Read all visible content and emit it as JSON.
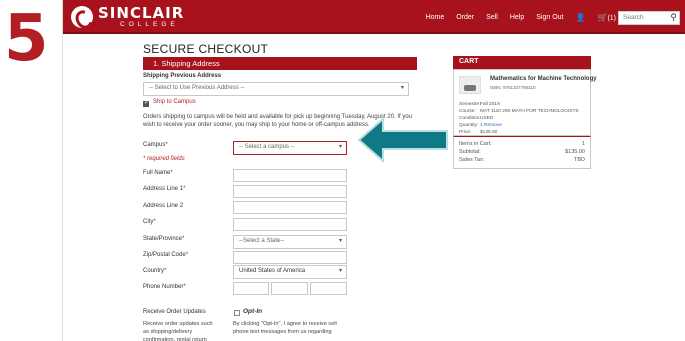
{
  "step": "5",
  "brand": {
    "name": "SINCLAIR",
    "sub": "COLLEGE"
  },
  "nav": [
    "Home",
    "Order",
    "Sell",
    "Help",
    "Sign Out"
  ],
  "cart_count": "(1)",
  "search_placeholder": "Search",
  "title": "SECURE CHECKOUT",
  "section": "1. Shipping Address",
  "shipping_prev_label": "Shipping Previous Address",
  "shipping_prev_select": "-- Select to Use Previous Address --",
  "ship_campus": "Ship to Campus",
  "ship_text": "Orders shipping to campus will be held and available for pick up beginning Tuesday, August 20. If you wish to receive your order sooner, you may ship to your home or off-campus address.",
  "campus_label": "Campus",
  "campus_select": "-- Select a campus --",
  "required_note": "* required fields",
  "fields": [
    {
      "label": "Full Name",
      "star": "*"
    },
    {
      "label": "Address Line 1",
      "star": "*"
    },
    {
      "label": "Address Line 2",
      "star": ""
    },
    {
      "label": "City",
      "star": "*"
    },
    {
      "label": "State/Province",
      "star": "*"
    },
    {
      "label": "Zip/Postal Code",
      "star": "*"
    },
    {
      "label": "Country",
      "star": "*"
    },
    {
      "label": "Phone Number",
      "star": "*"
    }
  ],
  "state_select": "--Select a State--",
  "country_select": "United States of America",
  "updates_label": "Receive Order Updates",
  "updates_text": "Receive order updates such as shipping/delivery confirmation, rental return",
  "optin_label": "Opt-In",
  "optin_text": "By clicking \"Opt-In\", I agree to receive cell phone text messages from us regarding",
  "cart": {
    "header": "CART",
    "book_title": "Mathematics for Machine Technology",
    "isbn": "ISBN: 9781337798310",
    "details": [
      {
        "k": "Semester:",
        "v": "Fall 2019"
      },
      {
        "k": "Course:",
        "v": "MAT 1110 290 MATH FOR TECHNOLOGISTS"
      },
      {
        "k": "Condition:",
        "v": "USED"
      },
      {
        "k": "Quantity:",
        "v": "1 Remove"
      },
      {
        "k": "Price:",
        "v": "$135.00"
      }
    ],
    "items_label": "Items in Cart:",
    "items_value": "1",
    "subtotal_label": "Subtotal:",
    "subtotal_value": "$135.00",
    "tax_label": "Sales Tax:",
    "tax_value": "TBD"
  },
  "colors": {
    "brand_red": "#a8121c",
    "arrow_teal": "#0f7a86"
  }
}
